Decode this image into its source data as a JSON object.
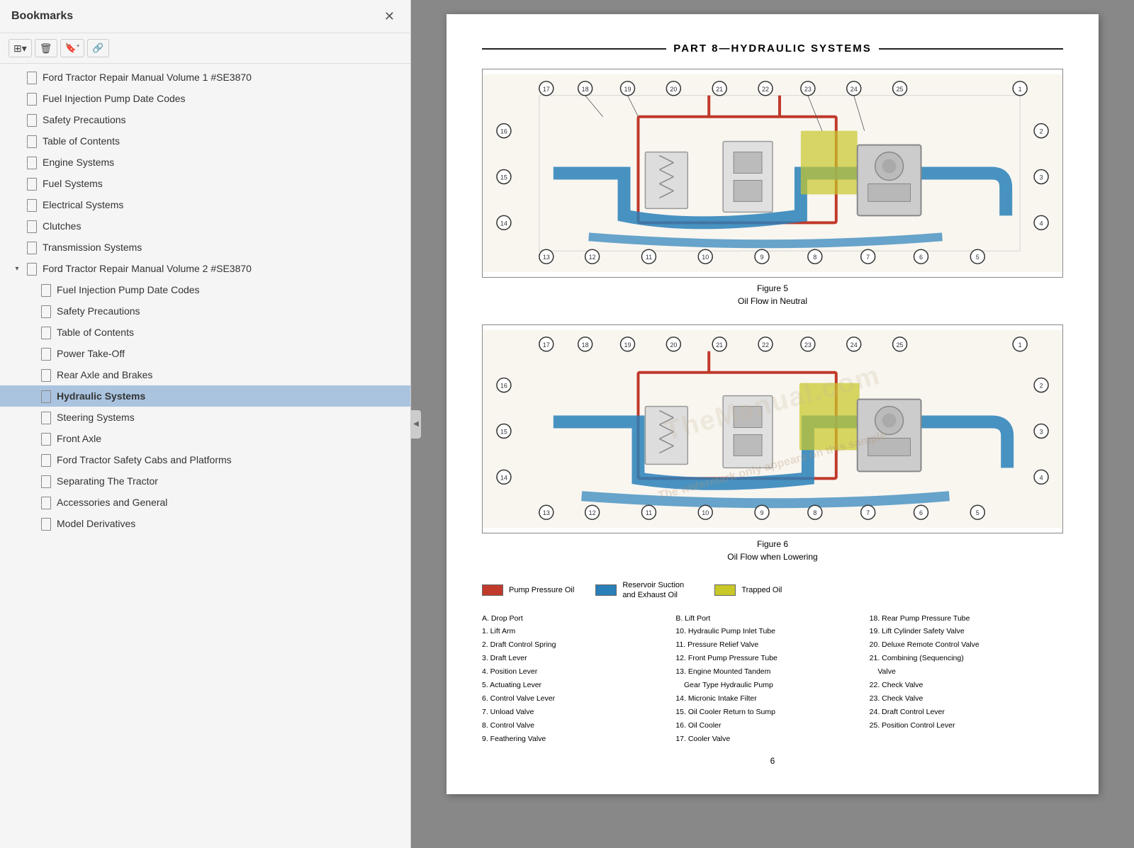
{
  "bookmarks": {
    "title": "Bookmarks",
    "close_label": "✕",
    "toolbar": {
      "btn1": "⊞",
      "btn1_dropdown": "▾",
      "btn2": "🗑",
      "btn3": "🔖",
      "btn4": "🔗"
    },
    "items": [
      {
        "id": "vol1",
        "label": "Ford Tractor Repair Manual Volume 1 #SE3870",
        "level": 1,
        "expandable": false,
        "expanded": false,
        "active": false
      },
      {
        "id": "fuel-inj-1",
        "label": "Fuel Injection Pump Date Codes",
        "level": 1,
        "expandable": false,
        "active": false
      },
      {
        "id": "safety-1",
        "label": "Safety Precautions",
        "level": 1,
        "expandable": false,
        "active": false
      },
      {
        "id": "toc-1",
        "label": "Table of Contents",
        "level": 1,
        "expandable": false,
        "active": false
      },
      {
        "id": "engine",
        "label": "Engine Systems",
        "level": 1,
        "expandable": false,
        "active": false
      },
      {
        "id": "fuel-sys",
        "label": "Fuel Systems",
        "level": 1,
        "expandable": false,
        "active": false
      },
      {
        "id": "electrical",
        "label": "Electrical Systems",
        "level": 1,
        "expandable": false,
        "active": false
      },
      {
        "id": "clutches",
        "label": "Clutches",
        "level": 1,
        "expandable": false,
        "active": false
      },
      {
        "id": "transmission",
        "label": "Transmission Systems",
        "level": 1,
        "expandable": false,
        "active": false
      },
      {
        "id": "vol2",
        "label": "Ford Tractor Repair Manual Volume 2 #SE3870",
        "level": 1,
        "expandable": true,
        "expanded": true,
        "active": false
      },
      {
        "id": "fuel-inj-2",
        "label": "Fuel Injection Pump Date Codes",
        "level": 2,
        "expandable": false,
        "active": false
      },
      {
        "id": "safety-2",
        "label": "Safety Precautions",
        "level": 2,
        "expandable": false,
        "active": false
      },
      {
        "id": "toc-2",
        "label": "Table of Contents",
        "level": 2,
        "expandable": false,
        "active": false
      },
      {
        "id": "pto",
        "label": "Power Take-Off",
        "level": 2,
        "expandable": false,
        "active": false
      },
      {
        "id": "rear-axle",
        "label": "Rear Axle and Brakes",
        "level": 2,
        "expandable": false,
        "active": false
      },
      {
        "id": "hydraulic",
        "label": "Hydraulic Systems",
        "level": 2,
        "expandable": false,
        "active": true
      },
      {
        "id": "steering",
        "label": "Steering Systems",
        "level": 2,
        "expandable": false,
        "active": false
      },
      {
        "id": "front-axle",
        "label": "Front Axle",
        "level": 2,
        "expandable": false,
        "active": false
      },
      {
        "id": "safety-cabs",
        "label": "Ford Tractor Safety Cabs and Platforms",
        "level": 2,
        "expandable": false,
        "active": false
      },
      {
        "id": "separating",
        "label": "Separating The Tractor",
        "level": 2,
        "expandable": false,
        "active": false
      },
      {
        "id": "accessories",
        "label": "Accessories and General",
        "level": 2,
        "expandable": false,
        "active": false
      },
      {
        "id": "model-deriv",
        "label": "Model Derivatives",
        "level": 2,
        "expandable": false,
        "active": false
      }
    ]
  },
  "pdf": {
    "part_title": "PART 8—HYDRAULIC SYSTEMS",
    "figure5": {
      "caption_title": "Figure 5",
      "caption_sub": "Oil Flow in Neutral"
    },
    "figure6": {
      "caption_title": "Figure 6",
      "caption_sub": "Oil Flow when Lowering"
    },
    "legend": [
      {
        "id": "pump",
        "color": "#c0392b",
        "label": "Pump Pressure Oil"
      },
      {
        "id": "reservoir",
        "color": "#2980b9",
        "label": "Reservoir Suction and Exhaust Oil"
      },
      {
        "id": "trapped",
        "color": "#c8c829",
        "label": "Trapped Oil"
      }
    ],
    "watermark_line1": "TheManual.com",
    "watermark_line2": "The watermark only appears on this sample",
    "parts_list": {
      "left": [
        "A. Drop Port",
        "1. Lift Arm",
        "2. Draft Control Spring",
        "3. Draft Lever",
        "4. Position Lever",
        "5. Actuating Lever",
        "6. Control Valve Lever",
        "7. Unload Valve",
        "8. Control Valve",
        "9. Feathering Valve"
      ],
      "middle": [
        "B. Lift Port",
        "10. Hydraulic Pump Inlet Tube",
        "11. Pressure Relief Valve",
        "12. Front Pump Pressure Tube",
        "13. Engine Mounted Tandem Gear Type Hydraulic Pump",
        "14. Micronic Intake Filter",
        "15. Oil Cooler Return to Sump",
        "16. Oil Cooler",
        "17. Cooler Valve"
      ],
      "right": [
        "18. Rear Pump Pressure Tube",
        "19. Lift Cylinder Safety Valve",
        "20. Deluxe Remote Control Valve",
        "21. Combining (Sequencing) Valve",
        "22. Check Valve",
        "23. Check Valve",
        "24. Draft Control Lever",
        "25. Position Control Lever"
      ]
    },
    "page_number": "6"
  }
}
